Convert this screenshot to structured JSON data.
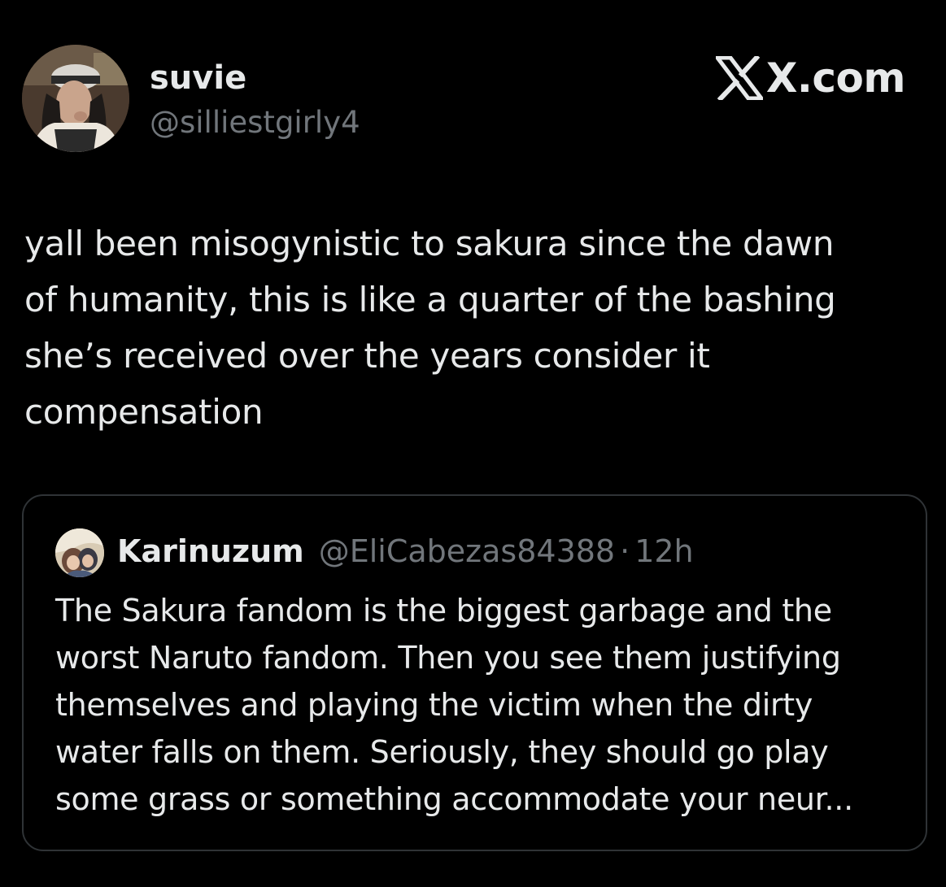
{
  "author": {
    "display_name": "suvie",
    "handle": "@silliestgirly4",
    "avatar": "profile-photo"
  },
  "brand": {
    "name": "X.com",
    "icon": "x-logo-icon"
  },
  "tweet": {
    "text": "yall been misogynistic to sakura since the dawn\nof humanity, this is like a quarter of the bashing\nshe’s received over the years consider it\ncompensation"
  },
  "quote": {
    "author_name": "Karinuzum",
    "author_handle": "@EliCabezas84388",
    "separator": "·",
    "time": "12h",
    "avatar": "profile-photo",
    "text": "The Sakura fandom is the biggest garbage and the\nworst Naruto fandom. Then you see them justifying\nthemselves and playing the victim when the dirty\nwater falls on them. Seriously, they should go play\nsome grass or something accommodate your neur..."
  },
  "colors": {
    "background": "#000000",
    "primary_text": "#e7e9ea",
    "secondary_text": "#71767b",
    "border": "#2f3336"
  }
}
